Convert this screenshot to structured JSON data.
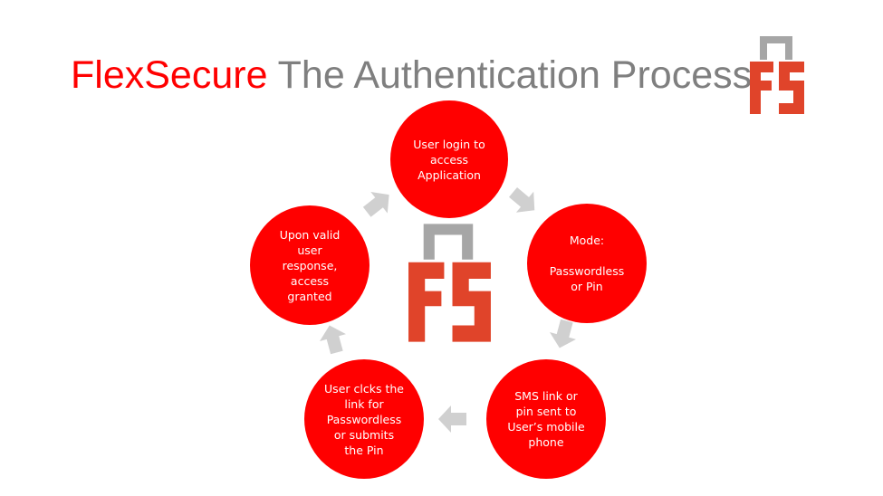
{
  "title": {
    "brand": "FlexSecure",
    "rest": "The Authentication Process"
  },
  "logo_text": "FS",
  "colors": {
    "node_fill": "#ff0000",
    "brand_red": "#ff0000",
    "title_gray": "#7f7f7f",
    "logo_red": "#e0442a",
    "logo_gray": "#a6a6a6",
    "arrow_gray": "#d0d0d0"
  },
  "nodes": [
    {
      "id": "login",
      "text": "User login to\naccess\nApplication"
    },
    {
      "id": "mode",
      "text": "Mode:\n\nPasswordless\nor Pin"
    },
    {
      "id": "sms",
      "text": "SMS link or\npin sent to\nUser’s mobile\nphone"
    },
    {
      "id": "user_clicks",
      "text": "User clcks the\nlink for\nPasswordless\nor submits\nthe Pin"
    },
    {
      "id": "granted",
      "text": "Upon valid\nuser\nresponse,\naccess\ngranted"
    }
  ],
  "arrows": [
    {
      "from": "login",
      "to": "mode"
    },
    {
      "from": "mode",
      "to": "sms"
    },
    {
      "from": "sms",
      "to": "user_clicks"
    },
    {
      "from": "user_clicks",
      "to": "granted"
    },
    {
      "from": "granted",
      "to": "login"
    }
  ]
}
